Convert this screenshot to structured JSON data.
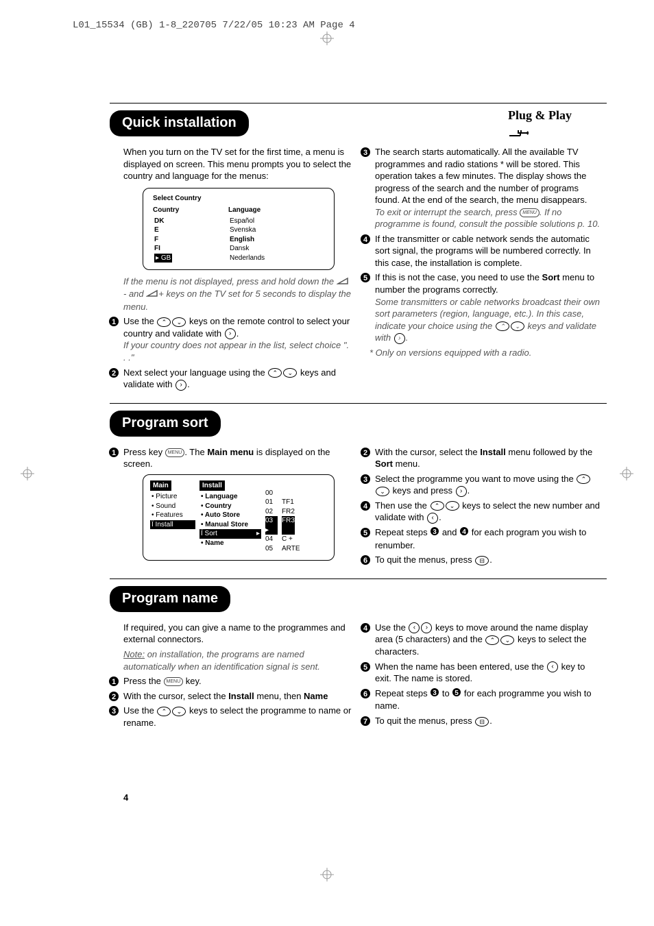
{
  "header_line": "L01_15534 (GB) 1-8_220705  7/22/05  10:23 AM  Page 4",
  "page_number": "4",
  "brand_text": "Plug & Play",
  "sections": {
    "quick": {
      "title": "Quick installation",
      "intro": "When you turn on the TV set for the first time, a menu is displayed on screen. This menu prompts you to select the country and language for the menus:",
      "note_below_osd": "If the menu is not displayed, press and hold down the",
      "note_below_osd_2": " keys on the TV set for 5 seconds to display the menu.",
      "step1_a": "Use the ",
      "step1_b": " keys on the remote control to select your country and validate with ",
      "step1_c": ".",
      "step1_note": "If your country does not appear in the list, select choice \". . .\"",
      "step2_a": "Next select your language using the ",
      "step2_b": " keys and validate with ",
      "step2_c": ".",
      "step3_a": "The search starts automatically. All the available TV programmes and radio stations * will be stored. This operation takes a few minutes. The display shows the progress of the search and the number of programs found.  At the end of the search, the menu disappears.",
      "step3_note_a": "To exit or interrupt the search, press ",
      "step3_note_b": ". If no programme is found, consult the possible solutions p. 10.",
      "step4": "If the transmitter or cable network sends the automatic sort signal, the programs will be numbered correctly. In this case, the installation is complete.",
      "step5_a": "If this is not the case, you need to use the ",
      "step5_bold": "Sort",
      "step5_b": " menu to number the programs correctly.",
      "step5_note_a": "Some transmitters or cable networks broadcast their own sort parameters (region, language, etc.). In this case, indicate your choice using the ",
      "step5_note_b": " keys and validate with ",
      "step5_note_c": ".",
      "footnote": "*   Only on versions equipped with a radio."
    },
    "sort": {
      "title": "Program sort",
      "step1_a": "Press key ",
      "step1_b": ". The ",
      "step1_bold": "Main menu",
      "step1_c": " is displayed on the screen.",
      "step2_a": "With the cursor, select the ",
      "step2_bold1": "Install",
      "step2_b": " menu followed by the ",
      "step2_bold2": "Sort",
      "step2_c": " menu.",
      "step3_a": "Select the programme you want to move using the ",
      "step3_b": " keys and press ",
      "step3_c": ".",
      "step4_a": "Then use the ",
      "step4_b": " keys to select the new number and validate with ",
      "step4_c": ".",
      "step5_a": "Repeat steps ",
      "step5_b": " and ",
      "step5_c": " for each program you wish to renumber.",
      "step6_a": "To quit the menus, press ",
      "step6_b": "."
    },
    "name": {
      "title": "Program name",
      "intro": "If required, you can give a name to the programmes and external connectors.",
      "intro_note_a": "Note:",
      "intro_note_b": " on installation, the programs are named automatically when an identification signal is sent.",
      "step1_a": "Press the ",
      "step1_b": " key.",
      "step2_a": "With the cursor, select the ",
      "step2_bold1": "Install",
      "step2_b": " menu, then ",
      "step2_bold2": "Name",
      "step3_a": "Use the ",
      "step3_b": " keys to select the programme to name or rename.",
      "step4_a": "Use the ",
      "step4_b": " keys to move around the name display area (5 characters) and the ",
      "step4_c": " keys to select the characters.",
      "step5_a": "When the name has been entered, use the ",
      "step5_b": " key to exit. The name is stored.",
      "step6_a": "Repeat steps ",
      "step6_b": " to ",
      "step6_c": " for each programme you wish to name.",
      "step7_a": "To quit the menus, press ",
      "step7_b": "."
    }
  },
  "osd1": {
    "title": "Select Country",
    "col1_header": "Country",
    "col2_header": "Language",
    "countries": [
      "DK",
      "E",
      "F",
      "FI",
      "GB"
    ],
    "country_sel_prefix": "▸ ",
    "languages": [
      "Español",
      "Svenska",
      "English",
      "Dansk",
      "Nederlands"
    ],
    "lang_bold_index": 2
  },
  "osd2": {
    "main_title": "Main",
    "main_items": [
      "• Picture",
      "• Sound",
      "• Features",
      "Ï Install"
    ],
    "install_title": "Install",
    "install_items": [
      "• Language",
      "• Country",
      "• Auto Store",
      "• Manual Store",
      "Ï Sort",
      "• Name"
    ],
    "install_sort_arrow": "▸",
    "programs": [
      {
        "n": "00",
        "name": ""
      },
      {
        "n": "01",
        "name": "TF1"
      },
      {
        "n": "02",
        "name": "FR2"
      },
      {
        "n": "03 ▸",
        "name": "FR3",
        "sel": true
      },
      {
        "n": "04",
        "name": "C +"
      },
      {
        "n": "05",
        "name": "ARTE"
      }
    ]
  }
}
